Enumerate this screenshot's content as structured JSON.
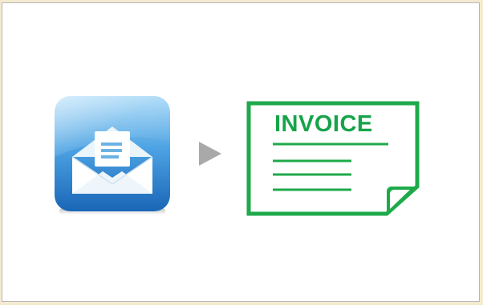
{
  "icons": {
    "mail": "envelope-icon",
    "arrow": "play-arrow-icon",
    "document": "invoice-document-icon"
  },
  "invoice": {
    "title": "INVOICE"
  },
  "colors": {
    "accent_green": "#1eaa4a",
    "mail_blue_top": "#8ec9f0",
    "mail_blue_bottom": "#1f6fc0",
    "arrow_gray": "#a9a9a9"
  }
}
